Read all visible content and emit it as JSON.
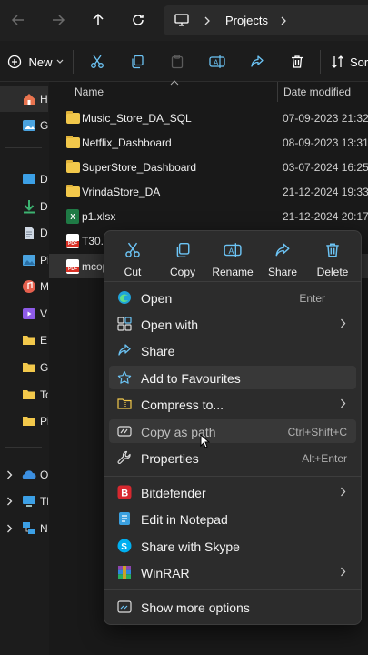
{
  "nav": {
    "breadcrumb": [
      "Projects"
    ]
  },
  "toolbar": {
    "new_label": "New",
    "sort_label": "Sor"
  },
  "sidebar": {
    "items": [
      {
        "label": "H",
        "icon": "home-icon",
        "color": "#e9744f"
      },
      {
        "label": "G",
        "icon": "gallery-icon",
        "color": "#4aa3df"
      },
      {
        "label": "D",
        "icon": "desktop-icon",
        "color": "#3ca0e6"
      },
      {
        "label": "D",
        "icon": "downloads-icon",
        "color": "#3cb371"
      },
      {
        "label": "D",
        "icon": "documents-icon",
        "color": "#cfd8e3"
      },
      {
        "label": "Pi",
        "icon": "pictures-icon",
        "color": "#4aa3df"
      },
      {
        "label": "M",
        "icon": "music-icon",
        "color": "#e6604e"
      },
      {
        "label": "V",
        "icon": "videos-icon",
        "color": "#8e5be8"
      },
      {
        "label": "E",
        "icon": "folder-icon",
        "color": "#f2c84b"
      },
      {
        "label": "G",
        "icon": "folder-icon",
        "color": "#f2c84b"
      },
      {
        "label": "To",
        "icon": "folder-icon",
        "color": "#f2c84b"
      },
      {
        "label": "Pi",
        "icon": "folder-icon",
        "color": "#f2c84b"
      },
      {
        "label": "O",
        "icon": "onedrive-icon",
        "color": "#3c8fe0"
      },
      {
        "label": "Th",
        "icon": "this-pc-icon",
        "color": "#3ca0e6"
      },
      {
        "label": "N",
        "icon": "network-icon",
        "color": "#3ca0e6"
      }
    ]
  },
  "filelist": {
    "col_name": "Name",
    "col_date": "Date modified",
    "rows": [
      {
        "name": "Music_Store_DA_SQL",
        "date": "07-09-2023 21:32",
        "type": "folder"
      },
      {
        "name": "Netflix_Dashboard",
        "date": "08-09-2023 13:31",
        "type": "folder"
      },
      {
        "name": "SuperStore_Dashboard",
        "date": "03-07-2024 16:25",
        "type": "folder"
      },
      {
        "name": "VrindaStore_DA",
        "date": "21-12-2024 19:33",
        "type": "folder"
      },
      {
        "name": "p1.xlsx",
        "date": "21-12-2024 20:17",
        "type": "xlsx"
      },
      {
        "name": "T30.p",
        "date": "",
        "type": "pdf"
      },
      {
        "name": "mcop",
        "date": "",
        "type": "pdf"
      }
    ]
  },
  "context_menu": {
    "quick_actions": [
      {
        "label": "Cut",
        "icon": "cut-icon"
      },
      {
        "label": "Copy",
        "icon": "copy-icon"
      },
      {
        "label": "Rename",
        "icon": "rename-icon"
      },
      {
        "label": "Share",
        "icon": "share-icon"
      },
      {
        "label": "Delete",
        "icon": "delete-icon"
      }
    ],
    "items": [
      {
        "label": "Open",
        "shortcut": "Enter",
        "icon": "edge-icon"
      },
      {
        "label": "Open with",
        "shortcut": "",
        "icon": "open-with-icon",
        "submenu": true
      },
      {
        "label": "Share",
        "shortcut": "",
        "icon": "share-icon"
      },
      {
        "label": "Add to Favourites",
        "shortcut": "",
        "icon": "star-icon"
      },
      {
        "label": "Compress to...",
        "shortcut": "",
        "icon": "compress-icon",
        "submenu": true
      },
      {
        "label": "Copy as path",
        "shortcut": "Ctrl+Shift+C",
        "icon": "copy-path-icon"
      },
      {
        "label": "Properties",
        "shortcut": "Alt+Enter",
        "icon": "wrench-icon"
      },
      {
        "label": "Bitdefender",
        "shortcut": "",
        "icon": "bitdefender-icon",
        "submenu": true
      },
      {
        "label": "Edit in Notepad",
        "shortcut": "",
        "icon": "notepad-icon"
      },
      {
        "label": "Share with Skype",
        "shortcut": "",
        "icon": "skype-icon"
      },
      {
        "label": "WinRAR",
        "shortcut": "",
        "icon": "winrar-icon",
        "submenu": true
      },
      {
        "label": "Show more options",
        "shortcut": "",
        "icon": "more-options-icon"
      }
    ]
  },
  "colors": {
    "accent": "#60cdff",
    "bitdefender": "#d7282f",
    "skype": "#00aff0"
  }
}
